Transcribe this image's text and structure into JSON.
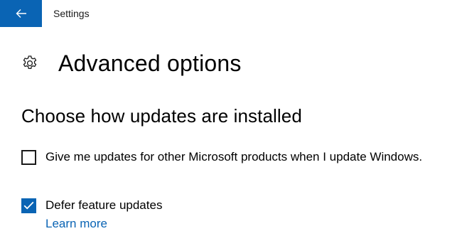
{
  "titlebar": {
    "back_icon": "back-arrow-icon",
    "app_title": "Settings"
  },
  "header": {
    "icon": "gear-icon",
    "title": "Advanced options"
  },
  "section": {
    "title": "Choose how updates are installed"
  },
  "options": [
    {
      "label": "Give me updates for other Microsoft products when I update Windows.",
      "checked": false
    },
    {
      "label": "Defer feature updates",
      "checked": true,
      "link": "Learn more"
    }
  ],
  "colors": {
    "accent": "#0a64b4",
    "text": "#000000",
    "background": "#ffffff"
  }
}
